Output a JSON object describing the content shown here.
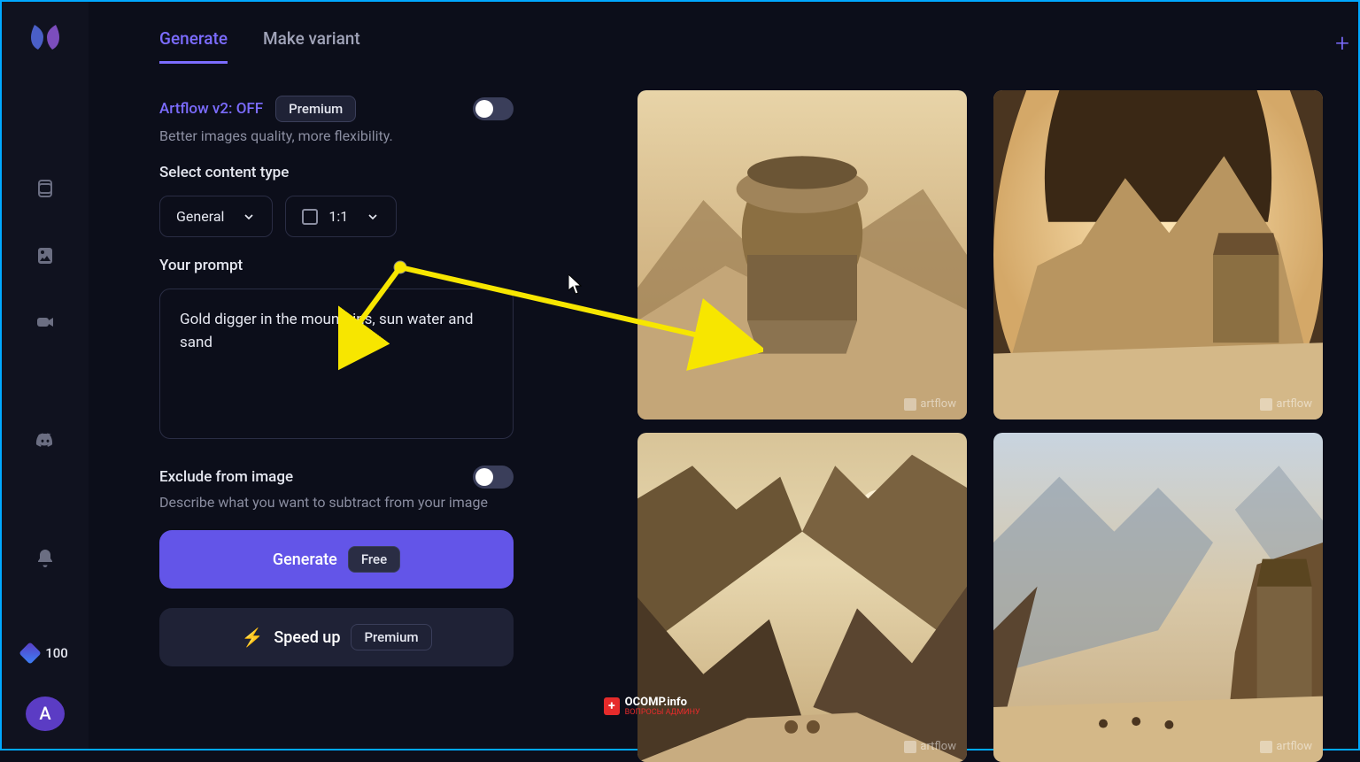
{
  "sidebar": {
    "credits": "100",
    "avatar_letter": "A"
  },
  "tabs": {
    "generate": "Generate",
    "variant": "Make variant"
  },
  "v2": {
    "label": "Artflow v2: OFF",
    "badge": "Premium",
    "desc": "Better images quality, more flexibility."
  },
  "content_type": {
    "label": "Select content type",
    "general": "General",
    "aspect": "1:1"
  },
  "prompt": {
    "label": "Your prompt",
    "value": "Gold digger in the mountains, sun water and sand"
  },
  "exclude": {
    "label": "Exclude from image",
    "desc": "Describe what you want to subtract from your image"
  },
  "buttons": {
    "generate": "Generate",
    "generate_badge": "Free",
    "speedup": "Speed up",
    "speedup_badge": "Premium"
  },
  "watermark": "artflow",
  "ocomp": {
    "text": "OCOMP.info",
    "sub": "ВОПРОСЫ АДМИНУ"
  }
}
